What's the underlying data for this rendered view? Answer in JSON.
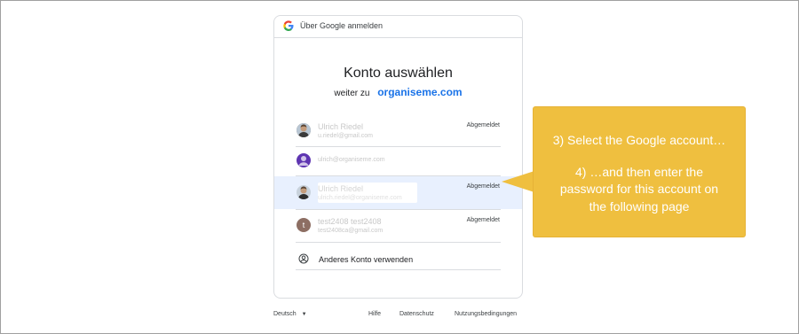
{
  "header": {
    "text": "Über Google anmelden"
  },
  "title": "Konto auswählen",
  "subtitle": {
    "prefix": "weiter zu",
    "link": "organiseme.com"
  },
  "accounts": [
    {
      "name": "Ulrich Riedel",
      "email": "u.riedel@gmail.com",
      "status": "Abgemeldet"
    },
    {
      "name": "",
      "email": "ulrich@organiseme.com",
      "status": ""
    },
    {
      "name": "Ulrich Riedel",
      "email": "ulrich.riedel@organiseme.com",
      "status": "Abgemeldet"
    },
    {
      "name": "test2408 test2408",
      "email": "test2408ca@gmail.com",
      "status": "Abgemeldet",
      "initial": "t"
    }
  ],
  "other_account": "Anderes Konto verwenden",
  "footer": {
    "language": "Deutsch",
    "help": "Hilfe",
    "privacy": "Datenschutz",
    "terms": "Nutzungsbedingungen"
  },
  "callout": {
    "line1": "3) Select the Google account…",
    "line2": "4) …and then enter the",
    "line3": "password for this account on",
    "line4": "the following page"
  },
  "colors": {
    "accent": "#1a73e8",
    "callout": "#efbf3f",
    "selected": "#e8f0fe"
  }
}
